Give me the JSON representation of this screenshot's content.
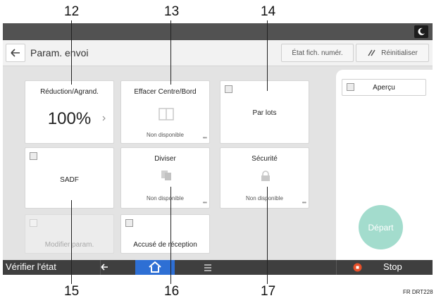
{
  "callouts": [
    "12",
    "13",
    "14",
    "15",
    "16",
    "17"
  ],
  "header": {
    "title": "Param. envoi",
    "scan_status_label": "État fich. numér.",
    "reset_label": "Réinitialiser"
  },
  "tiles": {
    "reduce_enlarge": {
      "title": "Réduction/Agrand.",
      "value": "100%"
    },
    "erase_center_border": {
      "title": "Effacer Centre/Bord",
      "status": "Non disponible"
    },
    "batch": {
      "title": "Par lots"
    },
    "sadf": {
      "title": "SADF"
    },
    "divide": {
      "title": "Diviser",
      "status": "Non disponible"
    },
    "security": {
      "title": "Sécurité",
      "status": "Non disponible"
    },
    "edit_settings": {
      "title": "Modifier param."
    },
    "receipt_notice": {
      "title": "Accusé de réception"
    }
  },
  "right_panel": {
    "preview_label": "Aperçu",
    "start_label": "Départ"
  },
  "bottom_bar": {
    "check_status_label": "Vérifier l'état",
    "stop_label": "Stop"
  },
  "footer_code": "FR DRT228",
  "colors": {
    "start_button": "#a3dccd",
    "home_tab": "#2e6fd4",
    "stop_icon": "#e8502a"
  }
}
